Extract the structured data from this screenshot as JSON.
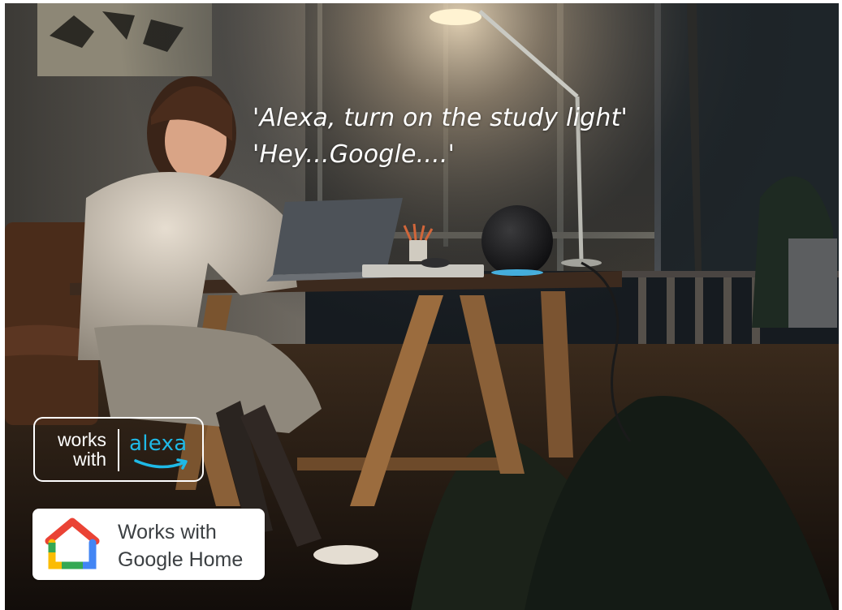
{
  "quote": {
    "line1": "'Alexa, turn on the study light'",
    "line2": "'Hey...Google....'"
  },
  "alexa_badge": {
    "works": "works",
    "with": "with",
    "brand": "alexa",
    "brand_color": "#1fb9e6"
  },
  "google_badge": {
    "line1": "Works with",
    "line2_brand": "Google",
    "line2_product": " Home"
  },
  "colors": {
    "lamp_glow": "#ffd89a",
    "speaker_ring": "#4ec9ff",
    "scene_dark": "#141a20"
  }
}
